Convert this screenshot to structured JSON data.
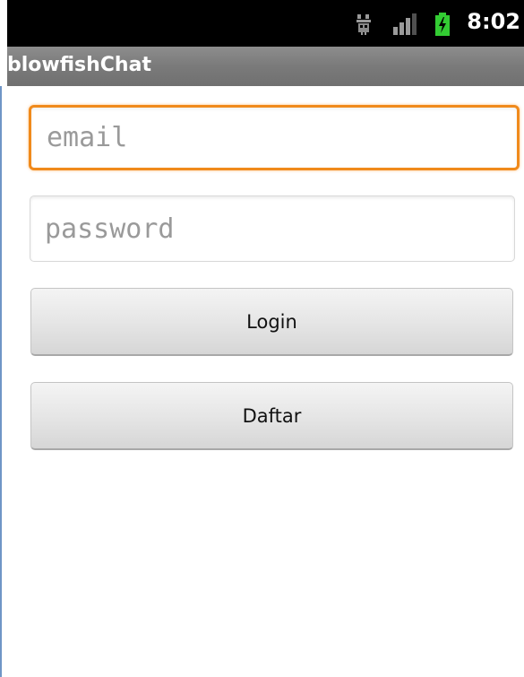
{
  "status_bar": {
    "time": "8:02",
    "icons": [
      "usb-debug-icon",
      "signal-icon",
      "battery-charging-icon"
    ],
    "colors": {
      "battery": "#33cc33",
      "background": "#000000"
    }
  },
  "app": {
    "title": "blowfishChat"
  },
  "form": {
    "email": {
      "value": "",
      "placeholder": "email"
    },
    "password": {
      "value": "",
      "placeholder": "password"
    },
    "login_label": "Login",
    "register_label": "Daftar"
  },
  "colors": {
    "focus_border": "#f08a1c",
    "title_bar": "#7f7f7f"
  }
}
